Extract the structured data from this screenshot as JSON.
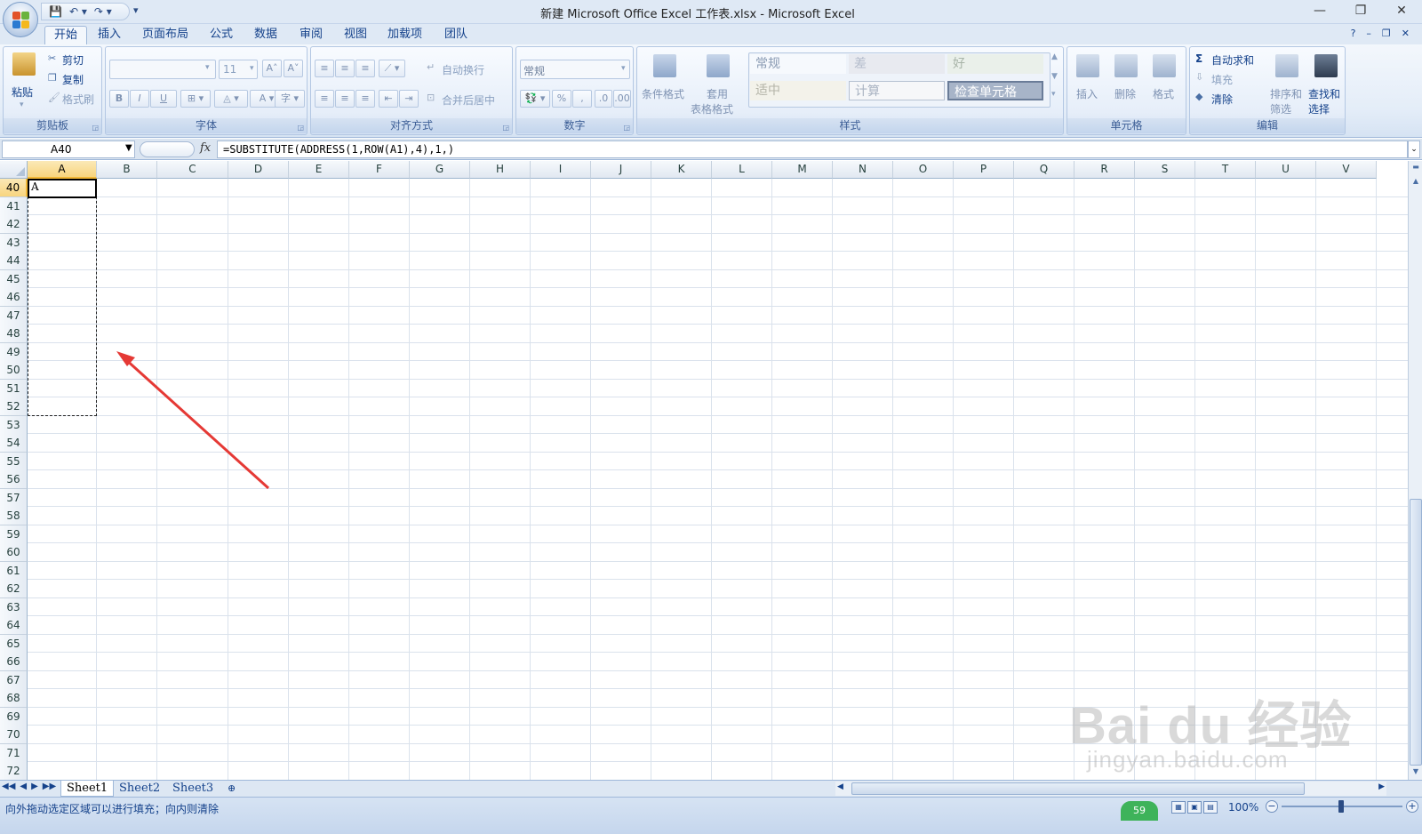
{
  "window": {
    "title": "新建 Microsoft Office Excel 工作表.xlsx - Microsoft Excel",
    "controls": [
      "—",
      "❐",
      "✕"
    ]
  },
  "qat": {
    "save": "💾",
    "undo": "↶ ▾",
    "redo": "↷ ▾",
    "more": "▾"
  },
  "tabs": [
    "开始",
    "插入",
    "页面布局",
    "公式",
    "数据",
    "审阅",
    "视图",
    "加载项",
    "团队"
  ],
  "tabs_right": [
    "?",
    "–",
    "❐",
    "✕"
  ],
  "ribbon": {
    "clipboard": {
      "paste": "粘贴",
      "cut": "剪切",
      "copy": "复制",
      "format_painter": "格式刷",
      "label": "剪贴板"
    },
    "font": {
      "font_size": "11",
      "grow": "A˄",
      "shrink": "A˅",
      "bold": "B",
      "italic": "I",
      "underline": "U",
      "label": "字体"
    },
    "alignment": {
      "wrap": "自动换行",
      "merge": "合并后居中",
      "label": "对齐方式"
    },
    "number": {
      "format": "常规",
      "percent": "%",
      "comma": ",",
      "label": "数字"
    },
    "styles": {
      "conditional": "条件格式",
      "table_line1": "套用",
      "table_line2": "表格格式",
      "normal": "常规",
      "bad": "差",
      "good": "好",
      "neutral": "适中",
      "calc": "计算",
      "check": "检查单元格",
      "label": "样式"
    },
    "cells": {
      "insert": "插入",
      "delete": "删除",
      "format": "格式",
      "label": "单元格"
    },
    "editing": {
      "autosum": "自动求和",
      "fill": "填充",
      "clear": "清除",
      "sort_line1": "排序和",
      "sort_line2": "筛选",
      "find_line1": "查找和",
      "find_line2": "选择",
      "label": "编辑"
    }
  },
  "formula_bar": {
    "name_box": "A40",
    "fx": "fx",
    "formula": "=SUBSTITUTE(ADDRESS(1,ROW(A1),4),1,)"
  },
  "grid": {
    "columns": [
      "A",
      "B",
      "C",
      "D",
      "E",
      "F",
      "G",
      "H",
      "I",
      "J",
      "K",
      "L",
      "M",
      "N",
      "O",
      "P",
      "Q",
      "R",
      "S",
      "T",
      "U",
      "V"
    ],
    "rows": [
      "40",
      "41",
      "42",
      "43",
      "44",
      "45",
      "46",
      "47",
      "48",
      "49",
      "50",
      "51",
      "52",
      "53",
      "54",
      "55",
      "56",
      "57",
      "58",
      "59",
      "60",
      "61",
      "62",
      "63",
      "64",
      "65",
      "66",
      "67",
      "68",
      "69",
      "70",
      "71",
      "72"
    ],
    "cell_a40": "A",
    "selected_column": "A",
    "selected_row": "40"
  },
  "watermark": {
    "main": "Bai du 经验",
    "sub": "jingyan.baidu.com"
  },
  "sheets": [
    "Sheet1",
    "Sheet2",
    "Sheet3"
  ],
  "sheet_nav": [
    "◀◀",
    "◀",
    "▶",
    "▶▶"
  ],
  "status": {
    "message": "向外拖动选定区域可以进行填充；向内则清除",
    "badge": "59",
    "zoom": "100%"
  },
  "colors": {
    "accent": "#15428b",
    "ribbon_bg": "#dfe9f5",
    "selection": "#f8d57e",
    "arrow": "#e53935"
  }
}
